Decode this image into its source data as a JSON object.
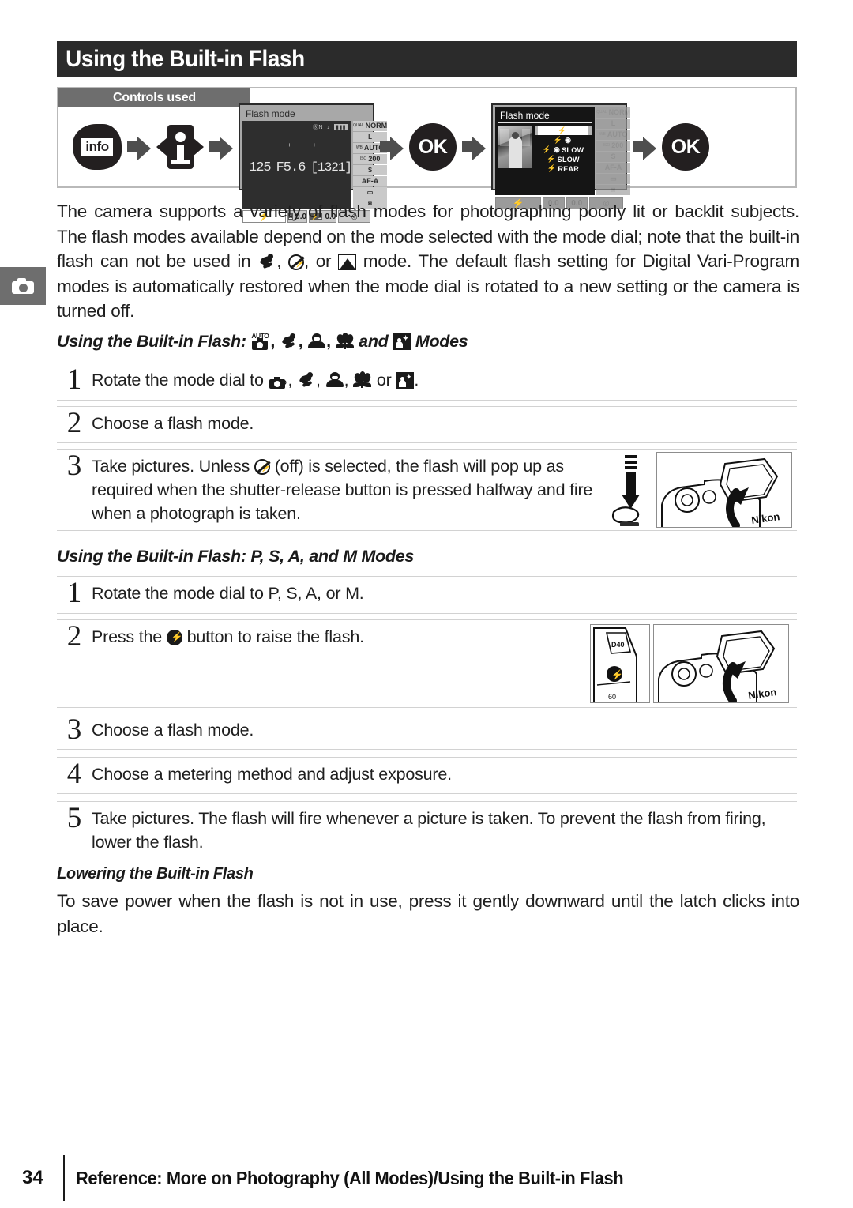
{
  "page": {
    "title": "Using the Built-in Flash",
    "number": "34",
    "footer_text": "Reference: More on Photography (All Modes)/Using the Built-in Flash",
    "margin_tab_icon": "camera-icon"
  },
  "controls_used": {
    "label": "Controls used",
    "sequence": [
      {
        "type": "button",
        "name": "info-button",
        "label": "info"
      },
      {
        "type": "arrow",
        "name": "flow-arrow"
      },
      {
        "type": "multi-selector",
        "name": "multi-selector-i",
        "label": "i"
      },
      {
        "type": "arrow",
        "name": "flow-arrow"
      },
      {
        "type": "lcd",
        "name": "info-display"
      },
      {
        "type": "arrow",
        "name": "flow-arrow"
      },
      {
        "type": "button",
        "name": "ok-button",
        "label": "OK"
      },
      {
        "type": "arrow",
        "name": "flow-arrow"
      },
      {
        "type": "lcd",
        "name": "flash-mode-menu"
      },
      {
        "type": "arrow",
        "name": "flow-arrow"
      },
      {
        "type": "button",
        "name": "ok-button",
        "label": "OK"
      }
    ],
    "ok_label": "OK",
    "info_label": "info",
    "i_label": "i"
  },
  "lcd_info_display": {
    "title": "Flash mode",
    "top_indicators": "N",
    "shutter_speed": "125",
    "aperture": "F5.6",
    "frames_remaining": "[1321]",
    "sidebar": [
      {
        "prefix": "QUAL",
        "value": "NORM"
      },
      {
        "prefix": "",
        "value": "L"
      },
      {
        "prefix": "WB",
        "value": "AUTO"
      },
      {
        "prefix": "ISO",
        "value": "200"
      },
      {
        "prefix": "",
        "value": "S"
      },
      {
        "prefix": "",
        "value": "AF-A"
      },
      {
        "prefix": "",
        "value": "▭"
      },
      {
        "prefix": "",
        "value": "◙"
      }
    ],
    "bottom": {
      "flash_icon": "⚡",
      "exposure_comp": "0.0",
      "flash_comp": "0.0"
    }
  },
  "lcd_flash_menu": {
    "title": "Flash mode",
    "options": [
      {
        "label": "",
        "icons": "⚡",
        "selected": true
      },
      {
        "label": "",
        "icons": "⚡ ◉",
        "selected": false
      },
      {
        "label": "SLOW",
        "icons": "⚡ ◉",
        "selected": false
      },
      {
        "label": "SLOW",
        "icons": "⚡",
        "selected": false
      },
      {
        "label": "REAR",
        "icons": "⚡",
        "selected": false
      }
    ],
    "sidebar": [
      "NORM",
      "L",
      "AUTO",
      "200",
      "S",
      "AF-A",
      "▭",
      "◙"
    ],
    "bottom": {
      "flash_icon": "⚡",
      "exposure_comp": "0.0",
      "flash_comp": "0.0"
    }
  },
  "intro": {
    "part1": "The camera supports a variety of flash modes for photographing poorly lit or backlit subjects.  The flash modes available depend on the mode selected with the mode dial; note that the built-in flash can not be used in ",
    "icon1": "sports-mode-icon",
    "sep1": ", ",
    "icon2": "flash-off-icon",
    "sep2": ", or ",
    "icon3": "landscape-mode-icon",
    "part2": " mode.  The default flash setting for Digital Vari-Program modes is automatically restored when the mode dial is rotated to a new setting or the camera is turned off."
  },
  "section_auto": {
    "heading_pre": "Using the Built-in Flash: ",
    "heading_icons": [
      "auto-mode-icon",
      "sports-mode-icon",
      "portrait-mode-icon",
      "close-up-mode-icon"
    ],
    "heading_and": " and ",
    "heading_last_icon": "night-portrait-mode-icon",
    "heading_post": " Modes",
    "steps": [
      {
        "number": "1",
        "text_pre": "Rotate the mode dial to ",
        "text_post": ".",
        "icons": [
          "auto-mode-icon",
          "sports-mode-icon",
          "portrait-mode-icon",
          "close-up-mode-icon"
        ],
        "or_label": " or ",
        "last_icon": "night-portrait-mode-icon"
      },
      {
        "number": "2",
        "text": "Choose a flash mode."
      },
      {
        "number": "3",
        "text_pre": "Take pictures.  Unless ",
        "icon": "flash-off-icon",
        "text_post": " (off) is selected, the flash will pop up as required when the shutter-release button is pressed halfway and fire when a photograph is taken.",
        "illustration": "camera-flash-popup-illustration"
      }
    ]
  },
  "section_psam": {
    "heading": "Using the Built-in Flash: P, S, A, and M Modes",
    "steps": [
      {
        "number": "1",
        "text": "Rotate the mode dial to P, S, A, or M."
      },
      {
        "number": "2",
        "text_pre": "Press the ",
        "icon": "flash-button-icon",
        "text_post": " button to raise the flash.",
        "illustration": "camera-flash-button-illustration"
      },
      {
        "number": "3",
        "text": "Choose a flash mode."
      },
      {
        "number": "4",
        "text": "Choose a metering method and adjust exposure."
      },
      {
        "number": "5",
        "text": "Take pictures.  The flash will fire  whenever a picture is taken.  To prevent the flash from firing, lower the flash."
      }
    ]
  },
  "section_lowering": {
    "heading": "Lowering the Built-in Flash",
    "text": "To save power when the flash is not in use, press it gently downward until the latch clicks into place."
  },
  "colors": {
    "header_bg": "#2b2b2b",
    "controls_label_bg": "#6e6e6e",
    "row_border": "#d2d2d2",
    "page_bg": "#ffffff",
    "text": "#1f1f1f"
  }
}
